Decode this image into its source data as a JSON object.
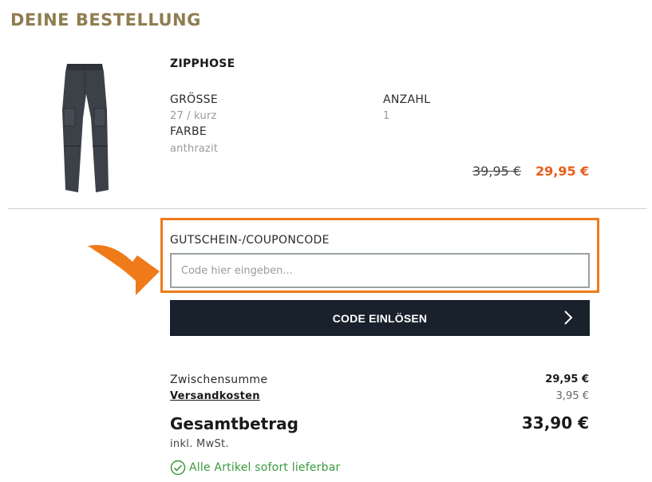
{
  "page": {
    "title": "DEINE BESTELLUNG"
  },
  "product": {
    "name": "ZIPPHOSE",
    "size_label": "GRÖSSE",
    "size_value": "27 / kurz",
    "color_label": "FARBE",
    "color_value": "anthrazit",
    "quantity_label": "ANZAHL",
    "quantity_value": "1",
    "old_price": "39,95 €",
    "new_price": "29,95 €",
    "image_icon": "pants-image"
  },
  "coupon": {
    "label": "GUTSCHEIN-/COUPONCODE",
    "placeholder": "Code hier eingeben...",
    "button_label": "CODE EINLÖSEN"
  },
  "summary": {
    "subtotal_label": "Zwischensumme",
    "subtotal_value": "29,95 €",
    "shipping_label": "Versandkosten",
    "shipping_value": "3,95 €",
    "total_label": "Gesamtbetrag",
    "total_value": "33,90 €",
    "vat_note": "inkl. MwSt.",
    "availability": "Alle Artikel sofort lieferbar"
  },
  "colors": {
    "heading": "#8f7d50",
    "sale_price": "#e85d1c",
    "highlight": "#ef7a1a",
    "button_bg": "#18212c",
    "available": "#3a9a3a"
  }
}
